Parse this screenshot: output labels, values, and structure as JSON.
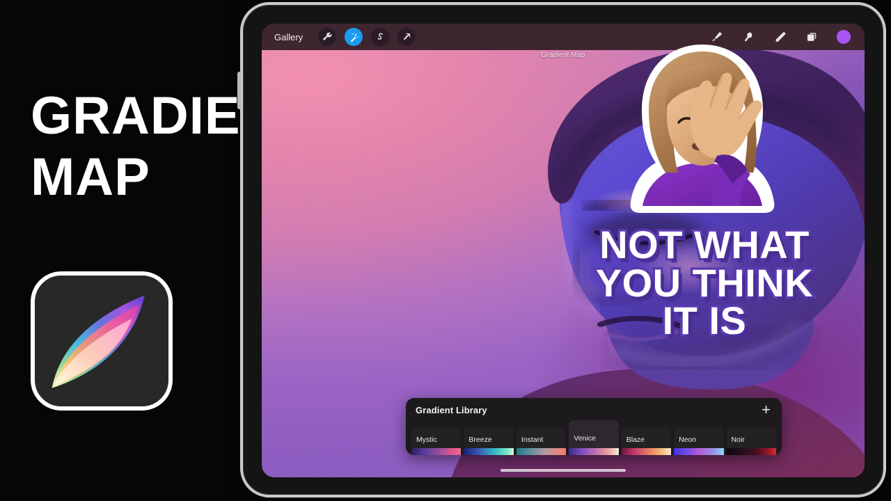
{
  "thumbnail": {
    "title_line_1": "Gradient",
    "title_line_2": "Map",
    "app_icon_name": "procreate-app-icon",
    "emoji_name": "woman-facepalming-emoji",
    "cta_line_1": "Not What",
    "cta_line_2": "You Think",
    "cta_line_3": "It Is",
    "accent_color": "#5b3ab0",
    "background_color": "#050505"
  },
  "device": {
    "name": "ipad-pro",
    "bezel_color": "#c9cace",
    "home_indicator": true
  },
  "app": {
    "name": "Procreate",
    "toolbar": {
      "gallery_label": "Gallery",
      "left_icons": [
        {
          "name": "wrench-icon",
          "glyph": "wrench",
          "active": false
        },
        {
          "name": "magic-wand-icon",
          "glyph": "wand",
          "active": true
        },
        {
          "name": "selection-icon",
          "glyph": "s-curve",
          "active": false
        },
        {
          "name": "transform-icon",
          "glyph": "arrow",
          "active": false
        }
      ],
      "right_icons": [
        {
          "name": "brush-icon",
          "glyph": "brush"
        },
        {
          "name": "smudge-icon",
          "glyph": "smudge"
        },
        {
          "name": "eraser-icon",
          "glyph": "eraser"
        },
        {
          "name": "layers-icon",
          "glyph": "layers"
        }
      ],
      "color_swatch": "#a855f7"
    },
    "canvas": {
      "title": "Gradient Map",
      "artwork_description": "portrait-gradient-map"
    },
    "gradient_library": {
      "title": "Gradient Library",
      "add_label": "+",
      "swatches": [
        {
          "name": "Mystic",
          "selected": false,
          "gradient": "linear-gradient(90deg,#2b1b5e 0%,#5b3fa0 28%,#a04f9e 58%,#e0548c 82%,#f06a8e 100%)"
        },
        {
          "name": "Breeze",
          "selected": false,
          "gradient": "linear-gradient(90deg,#1b2070 0%,#3a58b8 30%,#33b9c4 62%,#7fe6c2 88%,#d9f7d8 100%)"
        },
        {
          "name": "Instant",
          "selected": false,
          "gradient": "linear-gradient(90deg,#1a7d86 0%,#6d8fa0 32%,#b49aa2 58%,#e08a7e 82%,#f2796c 100%)"
        },
        {
          "name": "Venice",
          "selected": true,
          "gradient": "linear-gradient(90deg,#3a2a8e 0%,#7b4fc0 26%,#c06fb4 52%,#e89a9c 76%,#f6ece0 100%)"
        },
        {
          "name": "Blaze",
          "selected": false,
          "gradient": "linear-gradient(90deg,#6b1540 0%,#c23a6c 26%,#e8845c 58%,#f3b878 80%,#fae8d4 100%)"
        },
        {
          "name": "Neon",
          "selected": false,
          "gradient": "linear-gradient(90deg,#4433e0 0%,#6b4ae8 24%,#b55fd8 52%,#9a8ae8 76%,#8fd6ef 100%)"
        },
        {
          "name": "Noir",
          "selected": false,
          "gradient": "linear-gradient(90deg,#0d0710 0%,#23101c 34%,#4a1020 62%,#9c1a28 86%,#e02a2a 100%)"
        }
      ]
    }
  }
}
